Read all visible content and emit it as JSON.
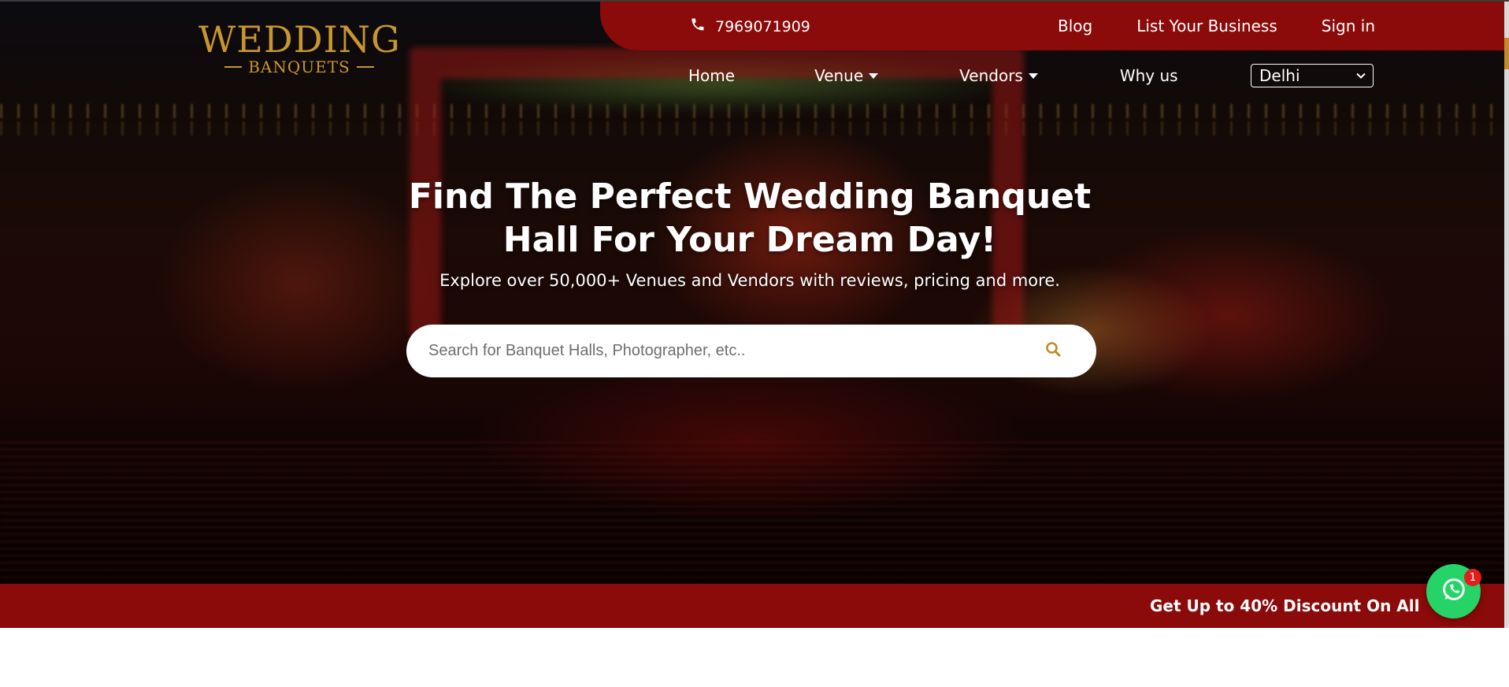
{
  "topbar": {
    "phone": "7969071909",
    "links": [
      "Blog",
      "List Your Business",
      "Sign in"
    ]
  },
  "logo": {
    "line1": "WEDDING",
    "line2": "BANQUETS"
  },
  "nav": {
    "home": "Home",
    "venue": "Venue",
    "vendors": "Vendors",
    "why_us": "Why us",
    "city": "Delhi"
  },
  "hero": {
    "title_line1": "Find The Perfect Wedding Banquet",
    "title_line2": "Hall For Your Dream Day!",
    "subtitle": "Explore over 50,000+ Venues and Vendors with reviews, pricing and more."
  },
  "search": {
    "placeholder": "Search for Banquet Halls, Photographer, etc.."
  },
  "promo": {
    "text": "Get Up to 40% Discount On All Our S"
  },
  "whatsapp": {
    "badge": "1"
  },
  "colors": {
    "brand_red": "#8b0a0a",
    "gold": "#c8962f",
    "whatsapp_green": "#25d366"
  }
}
